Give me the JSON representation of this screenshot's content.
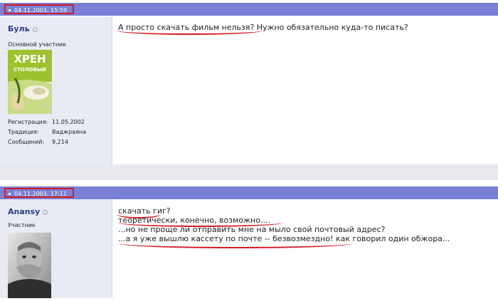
{
  "posts": [
    {
      "timestamp": "04.11.2003, 15:59",
      "username": "Буль",
      "rank": "Основной участник",
      "avatar_text": {
        "line1": "ХРЕН",
        "line2": "СТОЛОВЫЙ"
      },
      "stats": [
        {
          "label": "Регистрация:",
          "value": "11.05.2002"
        },
        {
          "label": "Традиция:",
          "value": "Ваджраяна"
        },
        {
          "label": "Сообщений:",
          "value": "9,214"
        }
      ],
      "message": [
        "А просто скачать фильм нельзя? Нужно обязательно куда-то писать?"
      ]
    },
    {
      "timestamp": "04.11.2003, 17:11",
      "username": "Anansy",
      "rank": "Участник",
      "message": [
        "скачать гиг?",
        "теоретически, конечно, возможно....",
        "...но не проще ли отправить мне на мыло свой почтовый адрес?",
        "...а я уже вышлю кассету по почте -- безвозмездно! как говорил один обжора..."
      ]
    }
  ],
  "colors": {
    "header_bar": "#7a80d6",
    "highlight_red": "#d01c23",
    "username_blue": "#2a3e89",
    "sidebar_bg": "#e8ebf3"
  }
}
